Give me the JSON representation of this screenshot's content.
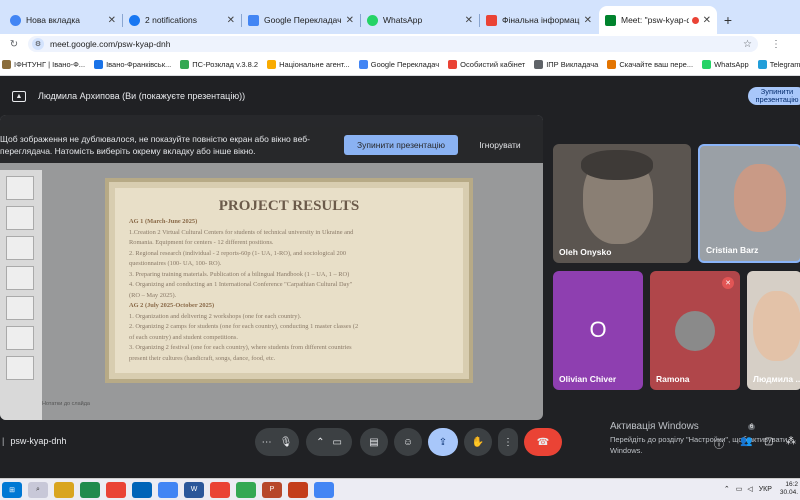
{
  "browser": {
    "tabs": [
      {
        "label": "Нова вкладка",
        "color": "#4285f4"
      },
      {
        "label": "2 notifications",
        "color": "#1877f2"
      },
      {
        "label": "Google Перекладач",
        "color": "#4285f4"
      },
      {
        "label": "WhatsApp",
        "color": "#25d366"
      },
      {
        "label": "Фінальна інформація для",
        "color": "#ea4335"
      },
      {
        "label": "Meet: \"psw-kyap-dnh\"",
        "color": "#00832d"
      }
    ],
    "new_tab": "+",
    "url": "meet.google.com/psw-kyap-dnh",
    "bookmarks": [
      {
        "label": "ІФНТУНГ | Івано-Ф...",
        "color": "#8a6d3b"
      },
      {
        "label": "Івано-Франківськ...",
        "color": "#1a73e8"
      },
      {
        "label": "ПС-Розклад v.3.8.2",
        "color": "#34a853"
      },
      {
        "label": "Національне агент...",
        "color": "#f9ab00"
      },
      {
        "label": "Google Перекладач",
        "color": "#4285f4"
      },
      {
        "label": "Особистий кабінет",
        "color": "#ea4335"
      },
      {
        "label": "ІПР Викладача",
        "color": "#5f6368"
      },
      {
        "label": "Скачайте ваш пере...",
        "color": "#e37400"
      },
      {
        "label": "WhatsApp",
        "color": "#25d366"
      },
      {
        "label": "Telegram",
        "color": "#229ed9"
      }
    ]
  },
  "meet": {
    "presenter_text": "Людмила Архипова (Ви (покажуєте презентацію))",
    "stop_top_label": "Зупинити презентацію",
    "warning": "Щоб зображення не дублювалося, не показуйте повністю екран або вікно веб-переглядача. Натомість виберіть окрему вкладку або інше вікно.",
    "stop_button": "Зупинити презентацію",
    "ignore_button": "Ігнорувати",
    "meeting_code": "psw-kyap-dnh",
    "participants": [
      {
        "name": "Oleh Onysko"
      },
      {
        "name": "Cristian Barz"
      },
      {
        "name": "Olivian Chiver",
        "initial": "O"
      },
      {
        "name": "Ramona"
      },
      {
        "name": "Людмила ..."
      }
    ]
  },
  "slide": {
    "title": "PROJECT RESULTS",
    "lines": [
      {
        "text": "AG 1 (March-June 2025)",
        "heading": true
      },
      {
        "text": "1.Creation 2 Virtual Cultural Centers for students of technical university in Ukraine and",
        "heading": false
      },
      {
        "text": "Romania. Equipment for centers - 12 different positions.",
        "heading": false
      },
      {
        "text": "2. Regional research (individual - 2 reports-60p (1- UA, 1-RO), and sociological 200",
        "heading": false
      },
      {
        "text": "questionnaires (100- UA, 100- RO).",
        "heading": false
      },
      {
        "text": "3. Preparing training materials. Publication of a bilingual Handbook (1 – UA, 1 – RO)",
        "heading": false
      },
      {
        "text": "4. Organizing and conducting an 1 International Conference \"Carpathian Cultural Day\"",
        "heading": false
      },
      {
        "text": "(RO – May 2025).",
        "heading": false
      },
      {
        "text": "AG 2 (July 2025-October 2025)",
        "heading": true
      },
      {
        "text": "1. Organization and delivering 2 workshops (one for each country).",
        "heading": false
      },
      {
        "text": "2. Organizing 2 camps for students (one for each country), conducting 1 master classes (2",
        "heading": false
      },
      {
        "text": "of each country) and student competitions.",
        "heading": false
      },
      {
        "text": "3. Organizing 2 festival (one for each country), where students from different countries",
        "heading": false
      },
      {
        "text": "present their cultures (handicraft, songs, dance, food, etc.",
        "heading": false
      }
    ],
    "notes": "Нотатки до слайда"
  },
  "windows": {
    "activation_title": "Активація Windows",
    "activation_text": "Перейдіть до розділу \"Настройки\", щоб активувати Windows.",
    "language": "УКР",
    "time": "16:2",
    "date": "30.04.",
    "badge_count": "6"
  },
  "colors": {
    "meet_bg": "#202124",
    "accent": "#8ab4f8",
    "hangup": "#ea4335"
  }
}
